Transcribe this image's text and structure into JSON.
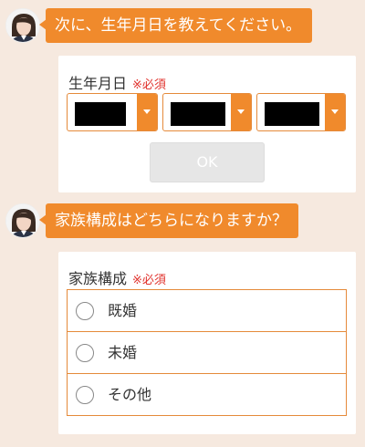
{
  "messages": [
    {
      "text": "次に、生年月日を教えてください。"
    },
    {
      "text": "家族構成はどちらになりますか？"
    }
  ],
  "birthdate_form": {
    "label": "生年月日",
    "required": "※必須",
    "selects": [
      {
        "value": ""
      },
      {
        "value": ""
      },
      {
        "value": ""
      }
    ],
    "ok_label": "OK"
  },
  "family_form": {
    "label": "家族構成",
    "required": "※必須",
    "options": [
      {
        "label": "既婚"
      },
      {
        "label": "未婚"
      },
      {
        "label": "その他"
      }
    ]
  },
  "colors": {
    "accent": "#f08a2c",
    "background": "#f6e9df",
    "required": "#e0302b"
  }
}
